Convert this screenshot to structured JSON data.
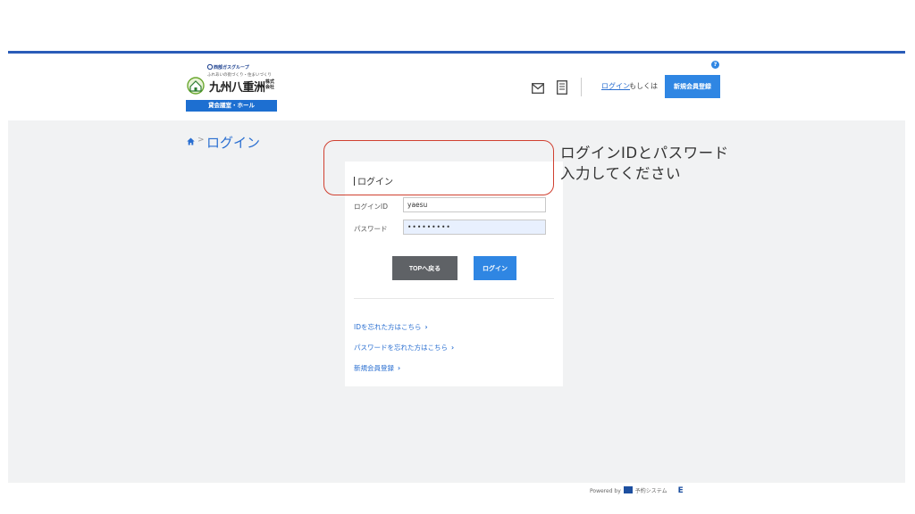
{
  "header": {
    "logo": {
      "group_name": "西部ガスグループ",
      "tagline": "ふれあいの街づくり・住まいづくり",
      "company_name": "九州八重洲",
      "company_suffix": "株式会社",
      "badge": "貸会議室・ホール"
    },
    "icons": {
      "mail": "mail-icon",
      "document": "document-icon",
      "help": "help-icon"
    },
    "login_link": "ログイン",
    "or_text": "もしくは",
    "register_button": "新規会員登録",
    "help_glyph": "?"
  },
  "breadcrumb": {
    "home_icon": "home-icon",
    "separator": ">",
    "current": "ログイン"
  },
  "login_panel": {
    "title": "ログイン",
    "id_label": "ログインID",
    "id_value": "yaesu",
    "password_label": "パスワード",
    "password_value": "yaesu1234",
    "top_button": "TOPへ戻る",
    "login_button": "ログイン",
    "links": {
      "forgot_id": "IDを忘れた方はこちら",
      "forgot_password": "パスワードを忘れた方はこちら",
      "register": "新規会員登録"
    },
    "chevron": "›"
  },
  "annotation": {
    "line1": "ログインIDとパスワード",
    "line2": "入力してください"
  },
  "footer": {
    "powered_by": "Powered by",
    "system_label": "予約システム"
  },
  "colors": {
    "accent_blue": "#2f86e3",
    "top_line": "#2a5cb8",
    "highlight_red": "#d04030",
    "background_gray": "#f1f2f3",
    "dark_button": "#5f6266"
  }
}
